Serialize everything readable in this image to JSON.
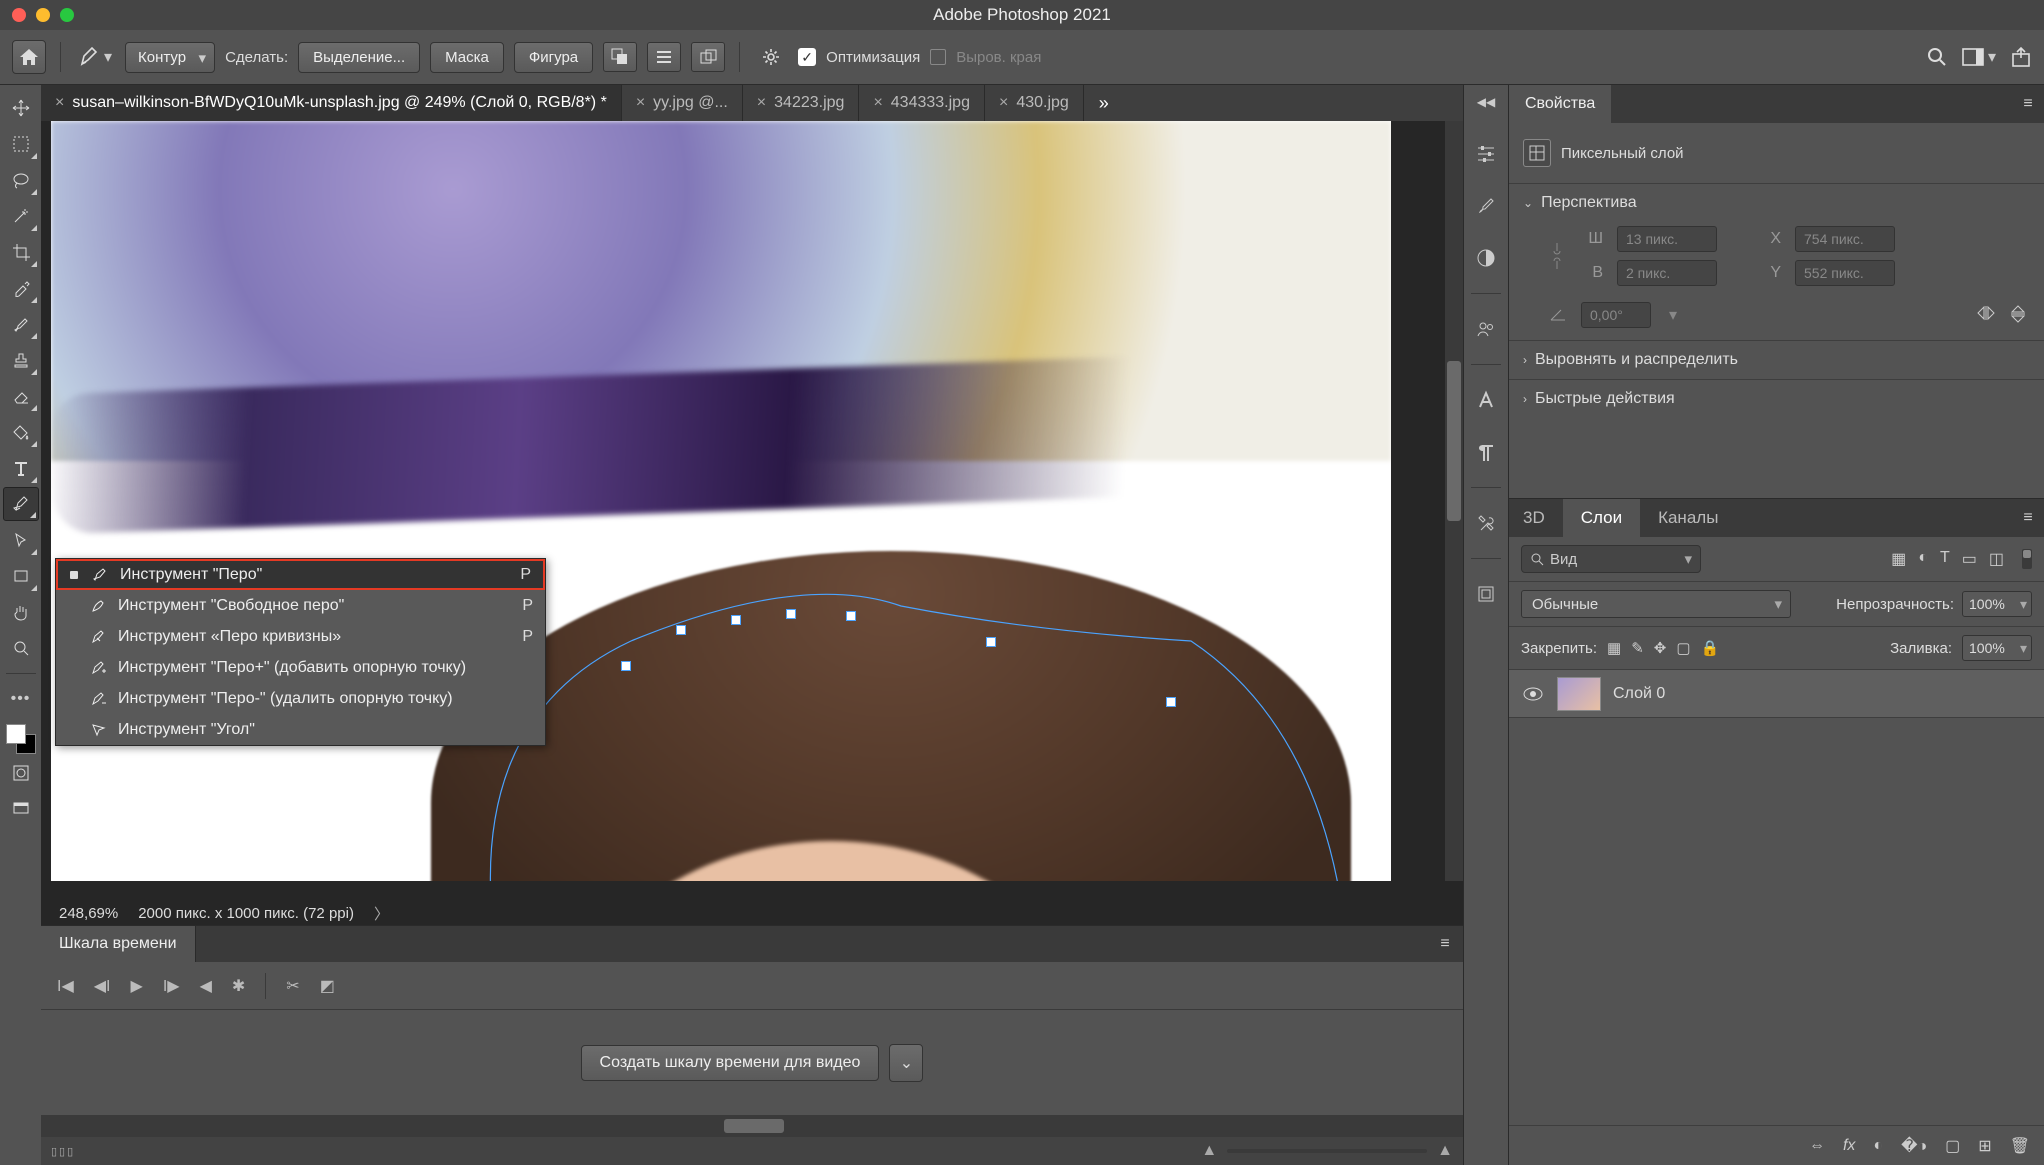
{
  "app": {
    "title": "Adobe Photoshop 2021"
  },
  "options": {
    "mode": "Контур",
    "make_label": "Сделать:",
    "selection": "Выделение...",
    "mask": "Маска",
    "shape": "Фигура",
    "optimize": "Оптимизация",
    "align_edges": "Выров. края"
  },
  "tabs": [
    {
      "label": "susan–wilkinson-BfWDyQ10uMk-unsplash.jpg @ 249% (Слой 0, RGB/8*) *",
      "active": true
    },
    {
      "label": "yy.jpg @..."
    },
    {
      "label": "34223.jpg"
    },
    {
      "label": "434333.jpg"
    },
    {
      "label": "430.jpg"
    }
  ],
  "flyout": {
    "items": [
      {
        "label": "Инструмент \"Перо\"",
        "shortcut": "P",
        "selected": true,
        "icon": "pen"
      },
      {
        "label": "Инструмент \"Свободное перо\"",
        "shortcut": "P",
        "icon": "freeform-pen"
      },
      {
        "label": "Инструмент «Перо кривизны»",
        "shortcut": "P",
        "icon": "curvature-pen"
      },
      {
        "label": "Инструмент \"Перо+\" (добавить опорную точку)",
        "icon": "pen-plus"
      },
      {
        "label": "Инструмент \"Перо-\" (удалить опорную точку)",
        "icon": "pen-minus"
      },
      {
        "label": "Инструмент \"Угол\"",
        "icon": "convert-point"
      }
    ]
  },
  "status": {
    "zoom": "248,69%",
    "dims": "2000 пикс. x 1000 пикс. (72 ppi)"
  },
  "timeline": {
    "title": "Шкала времени",
    "create": "Создать шкалу времени для видео"
  },
  "properties": {
    "title": "Свойства",
    "layer_kind": "Пиксельный слой",
    "sections": {
      "transform": {
        "title": "Перспектива",
        "W_label": "Ш",
        "W": "13 пикс.",
        "H_label": "В",
        "H": "2 пикс.",
        "X_label": "X",
        "X": "754 пикс.",
        "Y_label": "Y",
        "Y": "552 пикс.",
        "angle": "0,00°"
      },
      "align": "Выровнять и распределить",
      "quick": "Быстрые действия"
    }
  },
  "layers": {
    "tabs": {
      "d3": "3D",
      "layers": "Слои",
      "channels": "Каналы"
    },
    "filter_kind": "Вид",
    "blend_mode": "Обычные",
    "opacity_label": "Непрозрачность:",
    "opacity_value": "100%",
    "lock_label": "Закрепить:",
    "fill_label": "Заливка:",
    "fill_value": "100%",
    "items": [
      {
        "name": "Слой 0"
      }
    ]
  }
}
